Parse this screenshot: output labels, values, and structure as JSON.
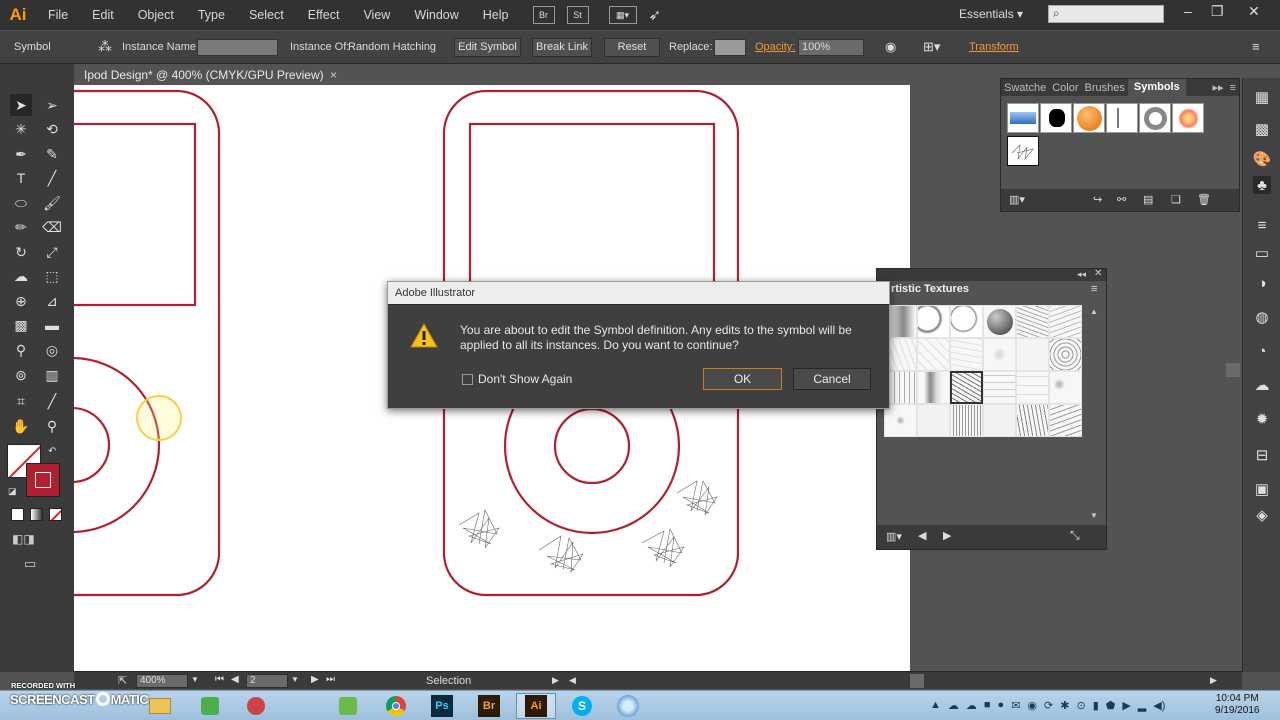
{
  "app": {
    "logo": "Ai",
    "menus": [
      "File",
      "Edit",
      "Object",
      "Type",
      "Select",
      "Effect",
      "View",
      "Window",
      "Help"
    ],
    "bridge_label": "Br",
    "stock_label": "St",
    "workspace": "Essentials"
  },
  "controlbar": {
    "type_label": "Symbol",
    "instance_name_label": "Instance Name:",
    "instance_of_label": "Instance Of:",
    "instance_of_value": "Random Hatching",
    "edit_symbol": "Edit Symbol",
    "break_link": "Break Link",
    "reset": "Reset",
    "replace_label": "Replace:",
    "opacity_label": "Opacity:",
    "opacity_value": "100%",
    "transform_label": "Transform"
  },
  "document": {
    "tab_title": "Ipod Design* @ 400% (CMYK/GPU Preview)",
    "close_glyph": "×"
  },
  "symbols_panel": {
    "tabs": [
      "Swatche",
      "Color",
      "Brushes",
      "Symbols"
    ],
    "selected_tab": "Symbols"
  },
  "textures_panel": {
    "title": "rtistic Textures"
  },
  "dialog": {
    "title": "Adobe Illustrator",
    "message": "You are about to edit the Symbol definition. Any edits to the symbol will be applied to all its instances. Do you want to continue?",
    "dont_show_label": "Don't Show Again",
    "ok_label": "OK",
    "cancel_label": "Cancel"
  },
  "statusbar": {
    "zoom": "400%",
    "artboard_num": "2",
    "status_text": "Selection"
  },
  "taskbar": {
    "time": "10:04 PM",
    "date": "9/19/2016",
    "watermark_top": "RECORDED WITH",
    "watermark_brand": "SCREENCAST",
    "watermark_suffix": "MATIC",
    "apps": [
      "Ps",
      "Br",
      "Ai"
    ]
  },
  "colors": {
    "accent": "#f29a38",
    "artwork_stroke": "#b0202e",
    "illustrator_orange": "#ff9a00"
  }
}
